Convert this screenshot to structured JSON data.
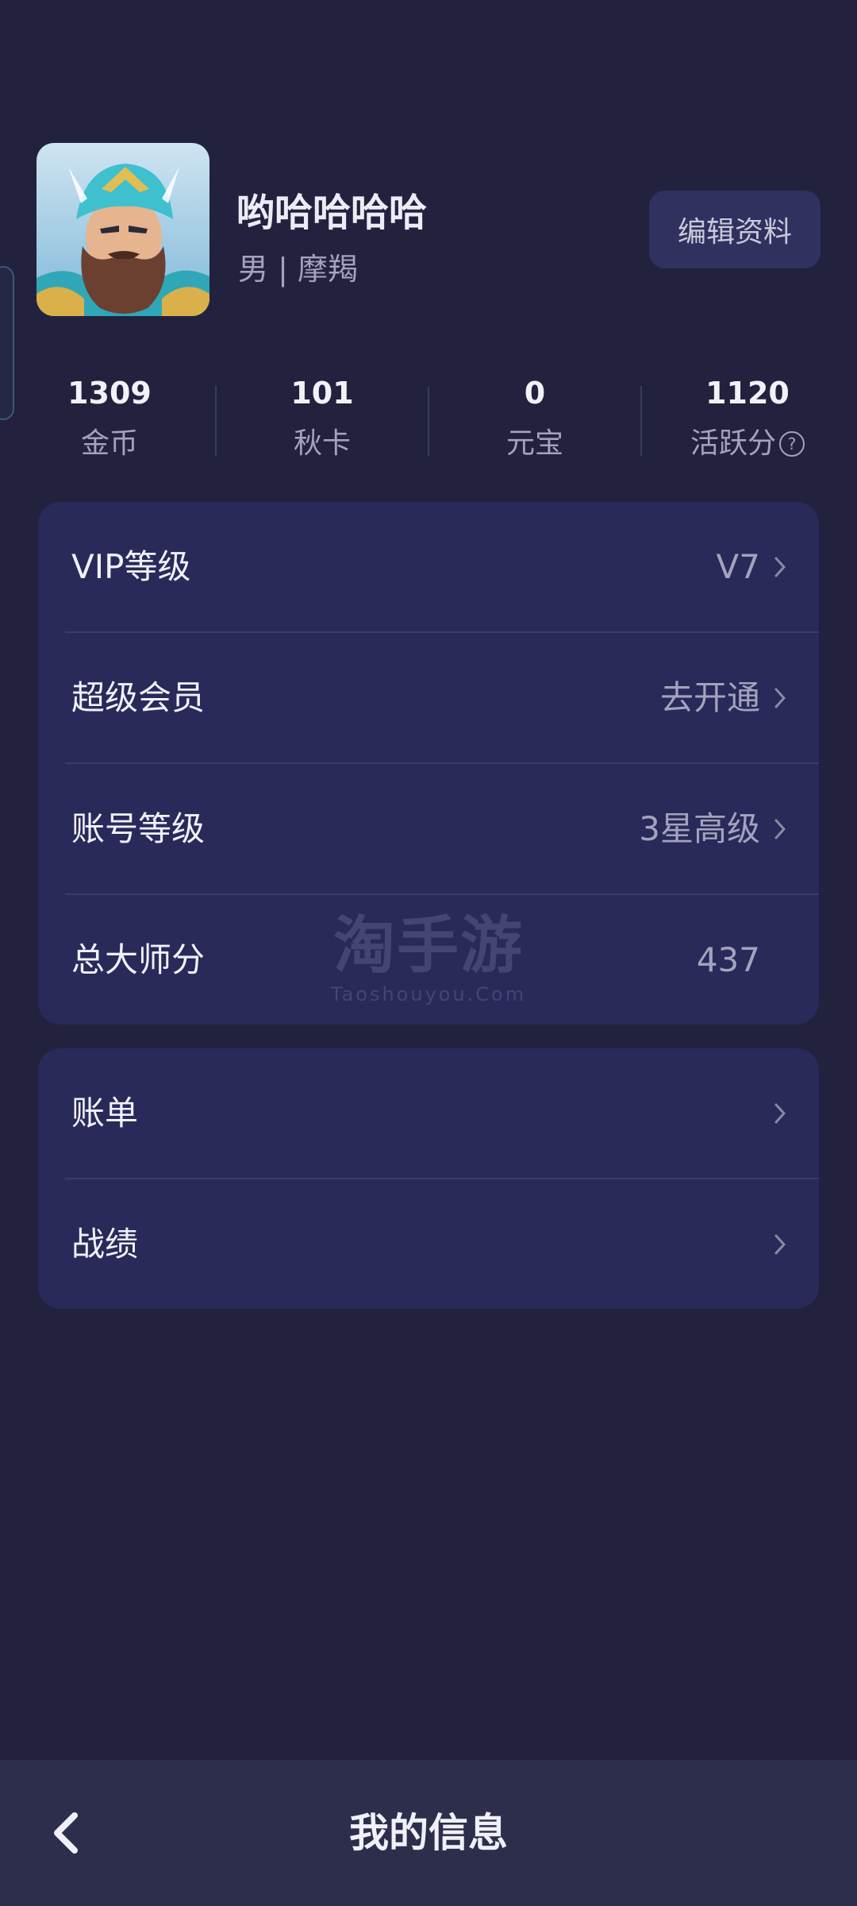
{
  "profile": {
    "username": "哟哈哈哈哈",
    "gender": "男",
    "separator": "|",
    "zodiac": "摩羯",
    "edit_label": "编辑资料"
  },
  "stats": [
    {
      "value": "1309",
      "label": "金币"
    },
    {
      "value": "101",
      "label": "秋卡"
    },
    {
      "value": "0",
      "label": "元宝"
    },
    {
      "value": "1120",
      "label": "活跃分",
      "help_icon": "question-circle-icon"
    }
  ],
  "account_card": {
    "rows": [
      {
        "label": "VIP等级",
        "value": "V7",
        "has_chevron": true
      },
      {
        "label": "超级会员",
        "value": "去开通",
        "has_chevron": true
      },
      {
        "label": "账号等级",
        "value": "3星高级",
        "has_chevron": true
      },
      {
        "label": "总大师分",
        "value": "437",
        "has_chevron": false
      }
    ]
  },
  "records_card": {
    "rows": [
      {
        "label": "账单",
        "value": "",
        "has_chevron": true
      },
      {
        "label": "战绩",
        "value": "",
        "has_chevron": true
      }
    ]
  },
  "watermark": {
    "cn": "淘手游",
    "en": "Taoshouyou.Com"
  },
  "bottom_bar": {
    "title": "我的信息",
    "back_icon": "chevron-left-icon"
  },
  "colors": {
    "background": "#22223e",
    "card": "#29295a",
    "button": "#313160",
    "bottom_bar": "#2d2d4c",
    "muted_text": "#a3a3bd"
  }
}
